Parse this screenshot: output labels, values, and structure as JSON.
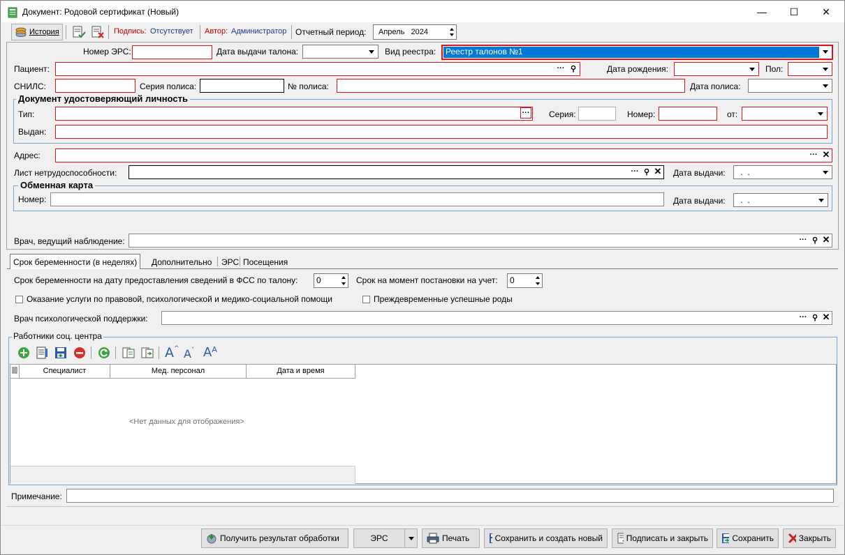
{
  "window": {
    "title": "Документ: Родовой сертификат (Новый)",
    "minimize": "—",
    "maximize": "☐",
    "close": "✕"
  },
  "toolbar": {
    "history_label": "История",
    "signature_label": "Подпись:",
    "signature_value": "Отсутствует",
    "author_label": "Автор:",
    "author_value": "Администратор",
    "period_label": "Отчетный период:",
    "period_value": "Апрель   2024"
  },
  "form": {
    "ers_number_label": "Номер ЭРС:",
    "ers_number_value": "",
    "coupon_date_label": "Дата выдачи талона:",
    "coupon_date_value": "",
    "registry_type_label": "Вид реестра:",
    "registry_type_value": "Реестр талонов №1",
    "patient_label": "Пациент:",
    "patient_value": "",
    "birth_date_label": "Дата рождения:",
    "birth_date_value": "",
    "sex_label": "Пол:",
    "sex_value": "",
    "snils_label": "СНИЛС:",
    "snils_value": "",
    "policy_series_label": "Серия полиса:",
    "policy_series_value": "",
    "policy_number_label": "№ полиса:",
    "policy_number_value": "",
    "policy_date_label": "Дата полиса:",
    "policy_date_value": "",
    "id_doc_group": "Документ удостоверяющий личность",
    "id_type_label": "Тип:",
    "id_series_label": "Серия:",
    "id_number_label": "Номер:",
    "id_from_label": "от:",
    "id_issued_label": "Выдан:",
    "address_label": "Адрес:",
    "sick_leave_label": "Лист нетрудоспособности:",
    "sick_leave_date_label": "Дата выдачи:",
    "sick_leave_date_value": " .  .",
    "exchange_card_group": "Обменная карта",
    "exchange_number_label": "Номер:",
    "exchange_date_label": "Дата выдачи:",
    "exchange_date_value": " .  .",
    "doctor_label": "Врач, ведущий наблюдение:"
  },
  "tabs": [
    {
      "label": "Срок беременности (в неделях)",
      "active": true
    },
    {
      "label": "Дополнительно",
      "active": false
    },
    {
      "label": "ЭРС",
      "active": false
    },
    {
      "label": "Посещения",
      "active": false
    }
  ],
  "pregnancy": {
    "term_fss_label": "Срок беременности на дату предоставления сведений в ФСС по талону:",
    "term_fss_value": "0",
    "term_registration_label": "Срок на момент постановки на учет:",
    "term_registration_value": "0",
    "legal_help_label": "Оказание услуги по правовой, психологической и медико-социальной помощи",
    "legal_help_checked": false,
    "premature_label": "Преждевременные успешные роды",
    "premature_checked": false,
    "psych_doctor_label": "Врач психологической поддержки:",
    "social_workers_group": "Работники соц. центра"
  },
  "grid": {
    "columns": [
      "Специалист",
      "Мед. персонал",
      "Дата и время"
    ],
    "empty_text": "<Нет данных для отображения>"
  },
  "note_label": "Примечание:",
  "buttons": {
    "get_result": "Получить результат обработки",
    "ers": "ЭРС",
    "print": "Печать",
    "save_new": "Сохранить и создать новый",
    "sign_close": "Подписать и закрыть",
    "save": "Сохранить",
    "close": "Закрыть"
  },
  "colors": {
    "required_border": "#d8141c",
    "group_border": "#7aa3cf",
    "selection": "#0078d7",
    "signature_value": "#1f3a93",
    "signature_label": "#c00000"
  }
}
